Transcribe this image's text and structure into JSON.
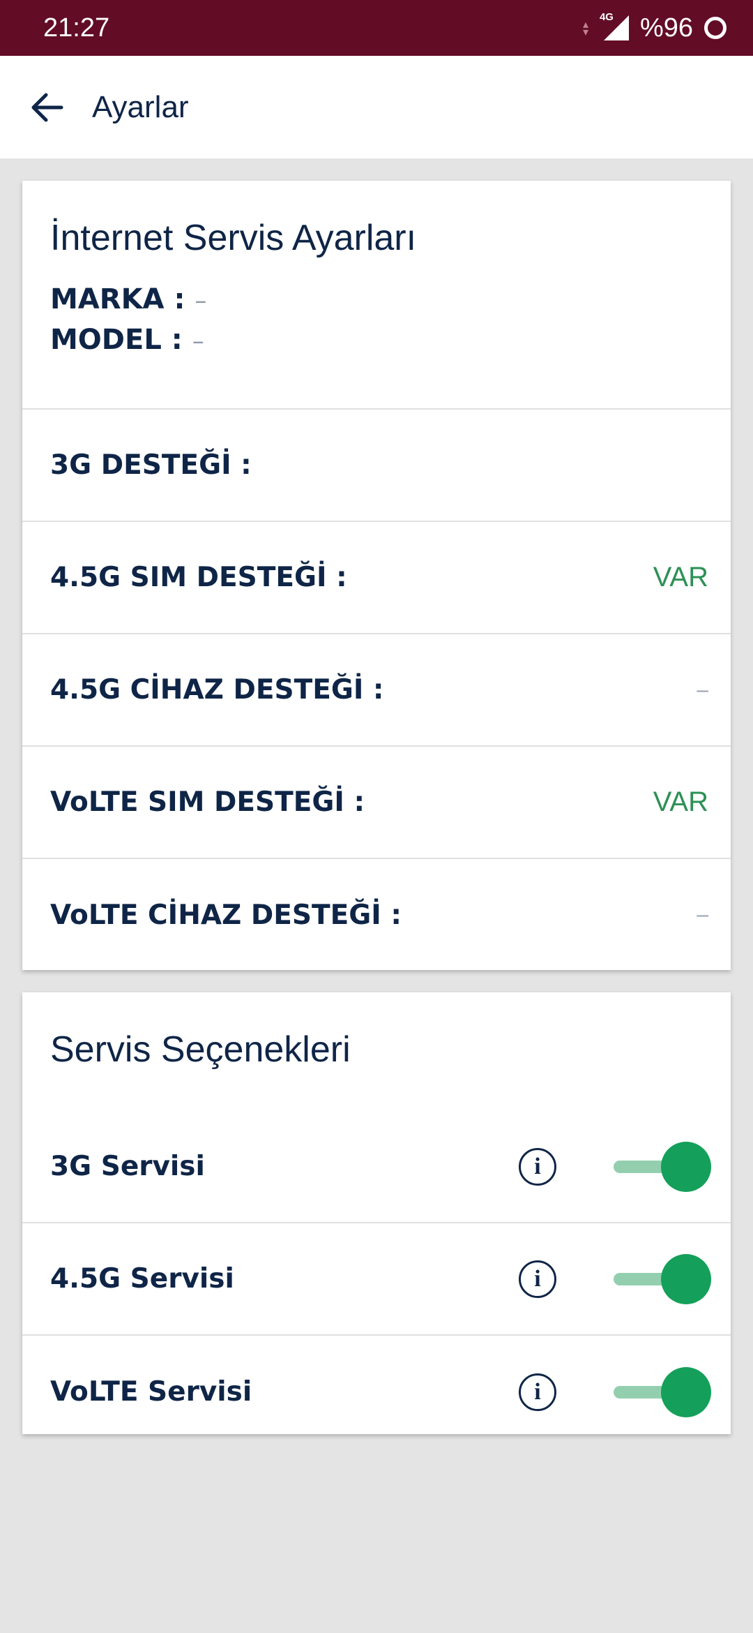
{
  "status_bar": {
    "time": "21:27",
    "network": "4G",
    "battery": "%96"
  },
  "app_bar": {
    "title": "Ayarlar"
  },
  "internet_settings": {
    "title": "İnternet Servis Ayarları",
    "brand_label": "MARKA :",
    "brand_value": "–",
    "model_label": "MODEL :",
    "model_value": "–",
    "rows": [
      {
        "label": "3G DESTEĞİ :",
        "value": ""
      },
      {
        "label": "4.5G SIM DESTEĞİ :",
        "value": "VAR"
      },
      {
        "label": "4.5G CİHAZ DESTEĞİ :",
        "value": "–"
      },
      {
        "label": "VoLTE SIM DESTEĞİ :",
        "value": "VAR"
      },
      {
        "label": "VoLTE CİHAZ DESTEĞİ :",
        "value": "–"
      }
    ]
  },
  "service_options": {
    "title": "Servis Seçenekleri",
    "services": [
      {
        "label": "3G Servisi",
        "info": "i",
        "enabled": true
      },
      {
        "label": "4.5G Servisi",
        "info": "i",
        "enabled": true
      },
      {
        "label": "VoLTE Servisi",
        "info": "i",
        "enabled": true
      }
    ]
  },
  "colors": {
    "status_bar": "#620c26",
    "text_primary": "#0f2547",
    "value_green": "#2d9055",
    "toggle_on": "#14a05a",
    "toggle_track": "#93cfae",
    "background": "#e4e4e4"
  },
  "icons": {
    "back": "arrow-left-icon",
    "signal": "signal-icon",
    "battery": "battery-ring-icon",
    "info": "info-icon"
  }
}
